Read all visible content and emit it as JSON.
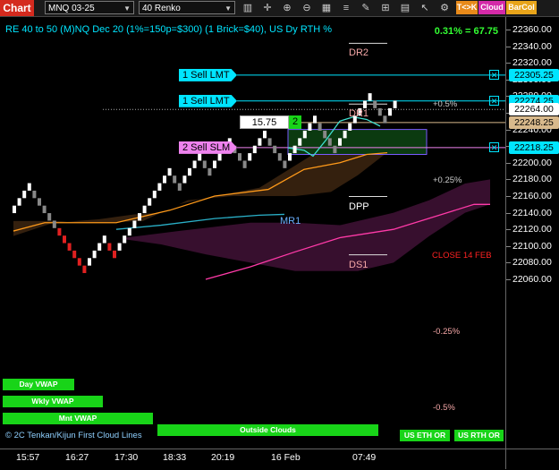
{
  "toolbar": {
    "chart_tab": "Chart",
    "symbol": "MNQ 03-25",
    "bar_type": "40 Renko",
    "tags": [
      {
        "label": "T<>K",
        "color": "#e88a1a"
      },
      {
        "label": "Cloud",
        "color": "#d42aa8"
      },
      {
        "label": "BarCol",
        "color": "#e8a41a"
      }
    ]
  },
  "header": {
    "title": "RE 40 to 50 (M)NQ Dec 20 (1%=150p=$300) (1 Brick=$40), US Dy RTH %",
    "pct_label": "0.31% = 67.75"
  },
  "orders": [
    {
      "label": "1 Sell LMT",
      "price": 22305.25,
      "color": "#00e5ff"
    },
    {
      "label": "1 Sell LMT",
      "price": 22274.25,
      "color": "#00e5ff"
    },
    {
      "label": "2 Sell SLM",
      "price": 22218.25,
      "color": "#ee82ee"
    }
  ],
  "position": {
    "qty_price": "15.75",
    "qty": "2",
    "price": 22248.25
  },
  "levels": [
    {
      "name": "DR2",
      "price": 22337
    },
    {
      "name": "DR1",
      "price": 22264
    },
    {
      "name": "DPP",
      "price": 22153
    },
    {
      "name": "DS1",
      "price": 22083
    }
  ],
  "labels": {
    "plus05": "+0.5%",
    "plus025": "+0.25%",
    "minus025": "-0.25%",
    "minus05": "-0.5%",
    "close": "CLOSE 14 FEB",
    "mr1": "MR1",
    "footer": "© 2C Tenkan/Kijun First Cloud Lines"
  },
  "indicator_bars": [
    {
      "label": "Day VWAP"
    },
    {
      "label": "Wkly VWAP"
    },
    {
      "label": "Mnt VWAP"
    },
    {
      "label": "Outside Clouds"
    },
    {
      "label": "US ETH OR"
    },
    {
      "label": "US RTH OR"
    }
  ],
  "yaxis": {
    "ticks": [
      22360,
      22340,
      22320,
      22300,
      22280,
      22260,
      22240,
      22220,
      22200,
      22180,
      22160,
      22140,
      22120,
      22100,
      22080,
      22060
    ],
    "tick_labels": [
      "22360.00",
      "22340.00",
      "22320.00",
      "22300.00",
      "22280.00",
      "22260.00",
      "22240.00",
      "22220.00",
      "22200.00",
      "22180.00",
      "22160.00",
      "22140.00",
      "22120.00",
      "22100.00",
      "22080.00",
      "22060.00"
    ],
    "current": "22264.00",
    "o1": "22305.25",
    "o2": "22274.25",
    "o3": "22218.25",
    "pos": "22248.25",
    "colors": {
      "order": "#00e5ff",
      "position": "#d8b98c",
      "current": "#ffffff"
    }
  },
  "xaxis": {
    "ticks": [
      "15:57",
      "16:27",
      "17:30",
      "18:33",
      "20:19",
      "16 Feb",
      "07:49"
    ]
  }
}
